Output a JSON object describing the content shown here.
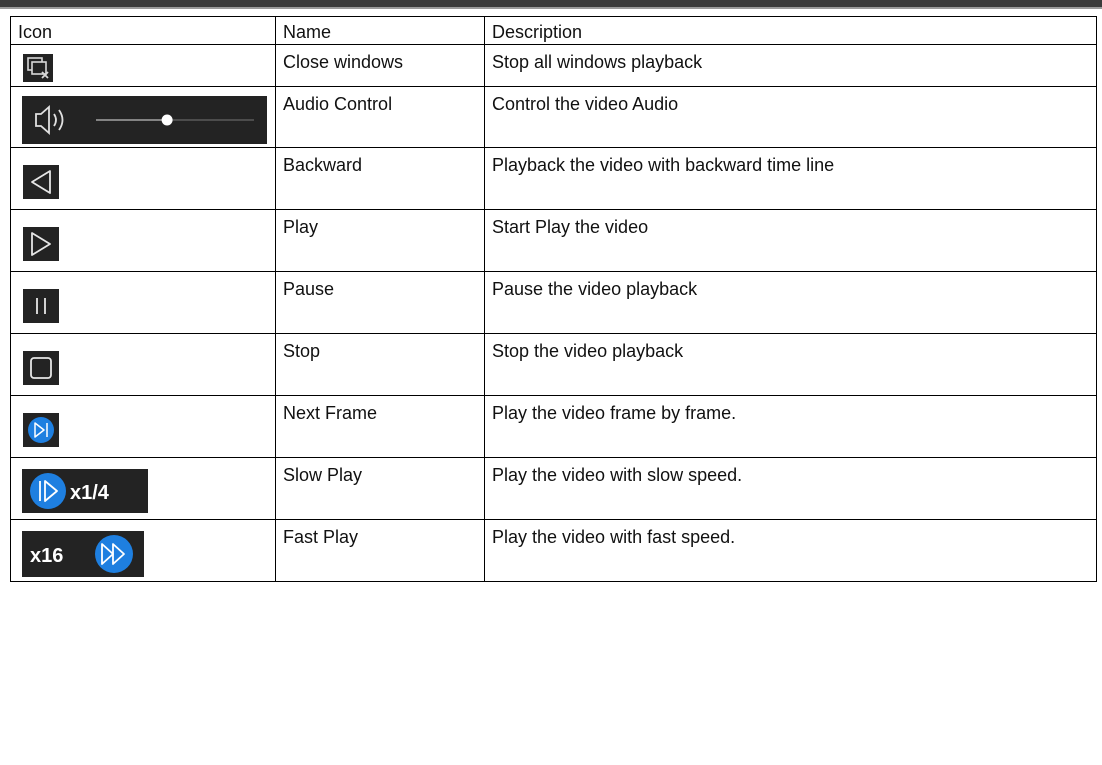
{
  "table": {
    "headers": {
      "icon": "Icon",
      "name": "Name",
      "description": "Description"
    },
    "rows": [
      {
        "icon": "close-windows-icon",
        "name": "Close windows",
        "description": "Stop all windows playback"
      },
      {
        "icon": "audio-control-icon",
        "name": "Audio Control",
        "description": "Control the video Audio",
        "volume_level": 0.45
      },
      {
        "icon": "backward-icon",
        "name": "Backward",
        "description": "Playback the video with backward time line"
      },
      {
        "icon": "play-icon",
        "name": "Play",
        "description": "Start Play the video"
      },
      {
        "icon": "pause-icon",
        "name": "Pause",
        "description": "Pause the video playback"
      },
      {
        "icon": "stop-icon",
        "name": "Stop",
        "description": "Stop the video playback"
      },
      {
        "icon": "next-frame-icon",
        "name": "Next Frame",
        "description": "Play the video frame by frame."
      },
      {
        "icon": "slow-play-icon",
        "name": "Slow Play",
        "description": "Play the video with slow speed.",
        "icon_text": "x1/4"
      },
      {
        "icon": "fast-play-icon",
        "name": "Fast Play",
        "description": "Play the video with fast speed.",
        "icon_text": "x16"
      }
    ]
  },
  "colors": {
    "icon_background": "#232323",
    "icon_stroke": "#e6e6e6",
    "accent_blue": "#1e7fe0"
  }
}
